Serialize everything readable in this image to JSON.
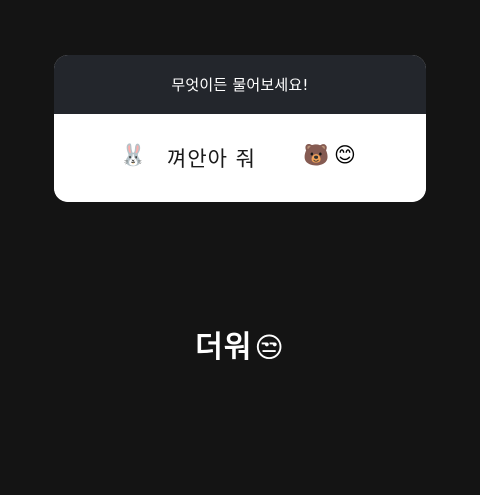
{
  "question_box": {
    "title": "무엇이든 물어보세요!",
    "answer": "껴안아 줘",
    "emoji_left": "🐰",
    "emoji_right_1": "🐻",
    "emoji_right_2": "😊"
  },
  "overlay": {
    "text": "더워",
    "emoji": "😒"
  },
  "colors": {
    "background": "#141414",
    "card_header": "#23262c",
    "card_body": "#ffffff"
  }
}
